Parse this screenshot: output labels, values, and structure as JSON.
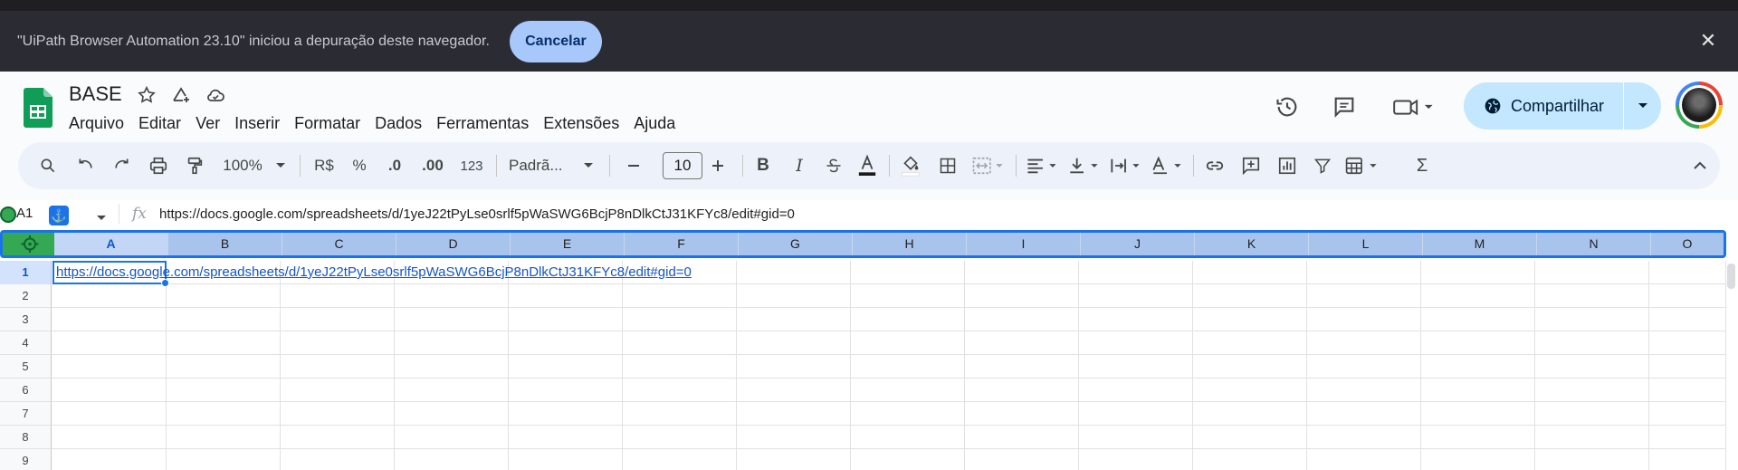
{
  "infobar": {
    "message": "\"UiPath Browser Automation 23.10\" iniciou a depuração deste navegador.",
    "cancel_label": "Cancelar",
    "close_icon": "close-icon"
  },
  "document": {
    "title": "BASE"
  },
  "menu": [
    "Arquivo",
    "Editar",
    "Ver",
    "Inserir",
    "Formatar",
    "Dados",
    "Ferramentas",
    "Extensões",
    "Ajuda"
  ],
  "share": {
    "label": "Compartilhar"
  },
  "toolbar": {
    "zoom": "100%",
    "currency": "R$",
    "percent": "%",
    "dec_decrease": ".0",
    "dec_increase": ".00",
    "format_more": "123",
    "font": "Padrã...",
    "font_size": "10"
  },
  "formula_bar": {
    "name_box": "A1",
    "fx": "fx",
    "content": "https://docs.google.com/spreadsheets/d/1yeJ22tPyLse0srlf5pWaSWG6BcjP8nDlkCtJ31KFYc8/edit#gid=0"
  },
  "grid": {
    "columns": [
      "A",
      "B",
      "C",
      "D",
      "E",
      "F",
      "G",
      "H",
      "I",
      "J",
      "K",
      "L",
      "M",
      "N",
      "O"
    ],
    "rows": [
      "1",
      "2",
      "3",
      "4",
      "5",
      "6",
      "7",
      "8",
      "9"
    ],
    "cell_a1": "https://docs.google.com/spreadsheets/d/1yeJ22tPyLse0srlf5pWaSWG6BcjP8nDlkCtJ31KFYc8/edit#gid=0",
    "selected_cell": "A1"
  },
  "colors": {
    "accent": "#1a73e8",
    "share_bg": "#c2e7ff",
    "sheets_green": "#0f9d58",
    "infobar_bg": "#2b2b33"
  }
}
